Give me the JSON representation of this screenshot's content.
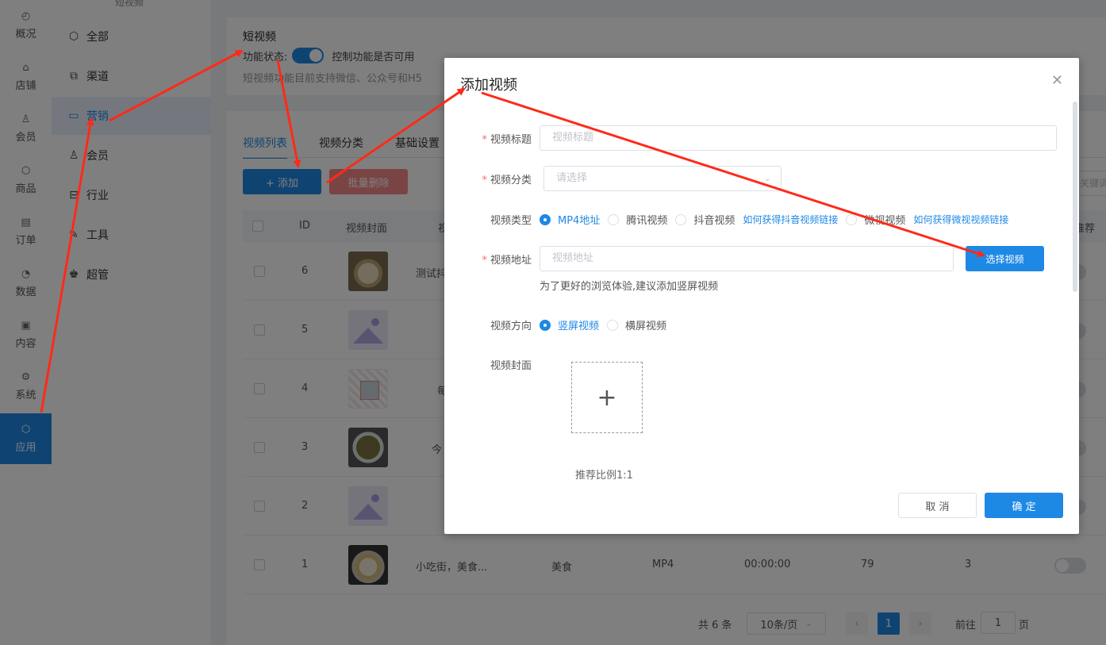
{
  "nav_primary": [
    {
      "label": "概况",
      "icon": "dashboard-icon"
    },
    {
      "label": "店铺",
      "icon": "store-icon"
    },
    {
      "label": "会员",
      "icon": "user-icon"
    },
    {
      "label": "商品",
      "icon": "box-icon"
    },
    {
      "label": "订单",
      "icon": "clipboard-icon"
    },
    {
      "label": "数据",
      "icon": "pie-icon"
    },
    {
      "label": "内容",
      "icon": "image-icon"
    },
    {
      "label": "系统",
      "icon": "gear-icon"
    },
    {
      "label": "应用",
      "icon": "cube-icon",
      "active": true
    }
  ],
  "nav_secondary": {
    "header": "短视频",
    "items": [
      {
        "label": "全部",
        "icon": "cube-icon"
      },
      {
        "label": "渠道",
        "icon": "channel-icon"
      },
      {
        "label": "营销",
        "icon": "chart-icon",
        "active": true
      },
      {
        "label": "会员",
        "icon": "user-icon"
      },
      {
        "label": "行业",
        "icon": "industry-icon"
      },
      {
        "label": "工具",
        "icon": "tool-icon"
      },
      {
        "label": "超管",
        "icon": "admin-icon"
      }
    ]
  },
  "feature": {
    "title": "短视频",
    "status_label": "功能状态:",
    "status_enabled": true,
    "status_hint": "控制功能是否可用",
    "description": "短视频功能目前支持微信、公众号和H5"
  },
  "tabs": [
    "视频列表",
    "视频分类",
    "基础设置"
  ],
  "toolbar": {
    "add_label": "+ 添加",
    "batch_delete_label": "批量删除",
    "keyword_placeholder": "关键词筛"
  },
  "table": {
    "headers": [
      "ID",
      "视频封面",
      "视",
      "推荐"
    ],
    "rows": [
      {
        "id": "6",
        "cover": "food1",
        "title": "测试抖",
        "category": "",
        "type": "",
        "duration": "",
        "views": "",
        "likes": ""
      },
      {
        "id": "5",
        "cover": "placeholder",
        "title": "",
        "category": "",
        "type": "",
        "duration": "",
        "views": "",
        "likes": ""
      },
      {
        "id": "4",
        "cover": "collage",
        "title": "每",
        "category": "",
        "type": "",
        "duration": "",
        "views": "",
        "likes": ""
      },
      {
        "id": "3",
        "cover": "food2",
        "title": "今",
        "category": "",
        "type": "",
        "duration": "",
        "views": "",
        "likes": ""
      },
      {
        "id": "2",
        "cover": "placeholder",
        "title": "",
        "category": "",
        "type": "",
        "duration": "",
        "views": "",
        "likes": ""
      },
      {
        "id": "1",
        "cover": "food3",
        "title": "小吃街，美食...",
        "category": "美食",
        "type": "MP4",
        "duration": "00:00:00",
        "views": "79",
        "likes": "3"
      }
    ]
  },
  "pagination": {
    "total": "共 6 条",
    "page_size": "10条/页",
    "current_page": "1",
    "goto_label": "前往",
    "goto_value": "1",
    "page_suffix": "页"
  },
  "modal": {
    "title": "添加视频",
    "fields": {
      "title_label": "视频标题",
      "title_placeholder": "视频标题",
      "category_label": "视频分类",
      "category_placeholder": "请选择",
      "type_label": "视频类型",
      "type_options": [
        "MP4地址",
        "腾讯视频",
        "抖音视频",
        "微视视频"
      ],
      "type_selected": "MP4地址",
      "douyin_help": "如何获得抖音视频链接",
      "weishi_help": "如何获得微视视频链接",
      "url_label": "视频地址",
      "url_placeholder": "视频地址",
      "pick_button": "选择视频",
      "url_hint": "为了更好的浏览体验,建议添加竖屏视频",
      "orientation_label": "视频方向",
      "orientation_options": [
        "竖屏视频",
        "横屏视频"
      ],
      "orientation_selected": "竖屏视频",
      "cover_label": "视频封面",
      "cover_ratio_hint": "推荐比例1:1"
    },
    "cancel_label": "取 消",
    "confirm_label": "确 定"
  },
  "colors": {
    "accent": "#1e88e5",
    "danger": "#f56c6c",
    "arrow": "#ff2a1a"
  }
}
